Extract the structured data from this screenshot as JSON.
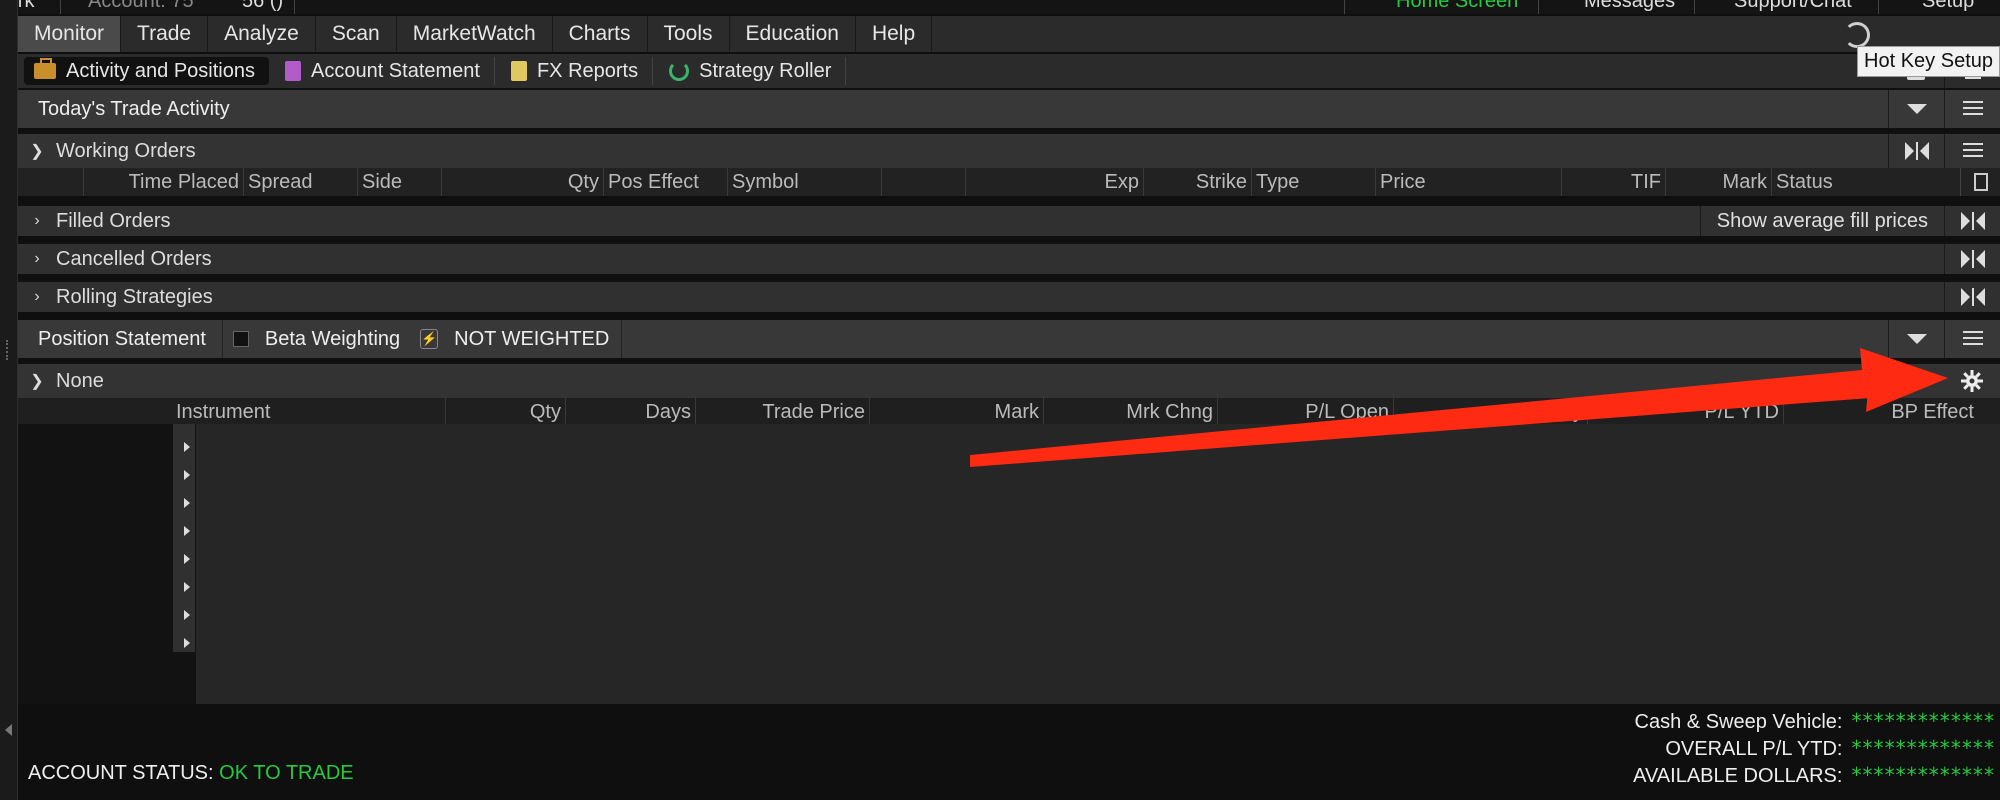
{
  "top_strip": {
    "items": [
      "rork",
      "Account: 75",
      "56 ()",
      "Home Screen",
      "Messages",
      "Support/Chat",
      "Setup"
    ]
  },
  "menu": {
    "tabs": [
      "Monitor",
      "Trade",
      "Analyze",
      "Scan",
      "MarketWatch",
      "Charts",
      "Tools",
      "Education",
      "Help"
    ],
    "active": "Monitor",
    "tooltip": "Hot Key Setup"
  },
  "subtabs": [
    {
      "label": "Activity and Positions",
      "icon": "briefcase-icon",
      "active": true
    },
    {
      "label": "Account Statement",
      "icon": "document-icon",
      "active": false
    },
    {
      "label": "FX Reports",
      "icon": "fx-report-icon",
      "active": false
    },
    {
      "label": "Strategy Roller",
      "icon": "refresh-icon",
      "active": false
    }
  ],
  "trade_activity": {
    "title": "Today's Trade Activity",
    "working_orders": {
      "label": "Working Orders",
      "columns": [
        "Time Placed",
        "Spread",
        "Side",
        "Qty",
        "Pos Effect",
        "Symbol",
        "Exp",
        "Strike",
        "Type",
        "Price",
        "TIF",
        "Mark",
        "Status"
      ]
    },
    "filled_orders": {
      "label": "Filled Orders",
      "action": "Show average fill prices"
    },
    "cancelled_orders": {
      "label": "Cancelled Orders"
    },
    "rolling_strategies": {
      "label": "Rolling Strategies"
    }
  },
  "position_statement": {
    "title": "Position Statement",
    "beta_label": "Beta Weighting",
    "weight_status": "NOT WEIGHTED",
    "group_label": "None",
    "columns": [
      "Instrument",
      "Qty",
      "Days",
      "Trade Price",
      "Mark",
      "Mrk Chng",
      "P/L Open",
      "P/L Day",
      "P/L YTD",
      "BP Effect"
    ],
    "row_count": 8
  },
  "summary": {
    "cash_label": "Cash & Sweep Vehicle:",
    "cash_value": "*************",
    "pl_ytd_label": "OVERALL P/L YTD:",
    "pl_ytd_value": "*************",
    "available_label": "AVAILABLE DOLLARS:",
    "available_value": "*************"
  },
  "account_status": {
    "label": "ACCOUNT STATUS:",
    "value": "OK TO TRADE"
  },
  "colors": {
    "accent_green": "#27c93f",
    "annotation_red": "#ff2a12",
    "active_tab": "#4a4a4a"
  }
}
